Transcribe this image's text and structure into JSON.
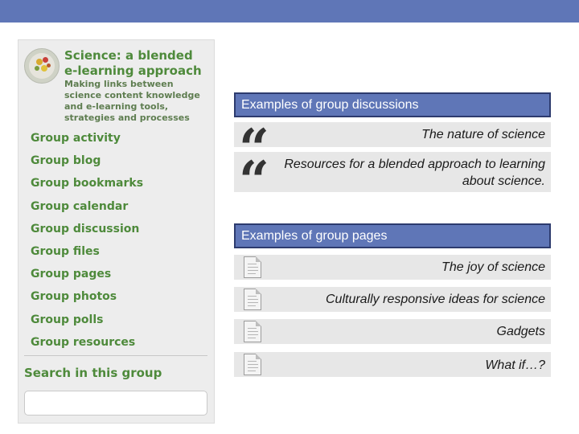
{
  "sidebar": {
    "group_title": "Science: a blended e-learning approach",
    "group_description": "Making links between science content knowledge and e-learning tools, strategies and processes",
    "menu": [
      "Group activity",
      "Group blog",
      "Group bookmarks",
      "Group calendar",
      "Group discussion",
      "Group files",
      "Group pages",
      "Group photos",
      "Group polls",
      "Group resources"
    ],
    "search_label": "Search in this group",
    "search_value": ""
  },
  "discussions": {
    "header": "Examples of group discussions",
    "items": [
      "The nature of science",
      "Resources for a blended approach to learning about science."
    ],
    "icon": "quote-icon"
  },
  "pages": {
    "header": "Examples of group pages",
    "items": [
      "The joy of science",
      "Culturally responsive ideas for science",
      "Gadgets",
      "What if…?"
    ],
    "icon": "page-icon"
  },
  "colors": {
    "top_bar": "#5f76b7",
    "header_fill": "#5f76b7",
    "header_border": "#2d3b6e",
    "menu_text": "#4e8a3b",
    "item_background": "#e7e7e7",
    "sidebar_background": "#ededed"
  }
}
